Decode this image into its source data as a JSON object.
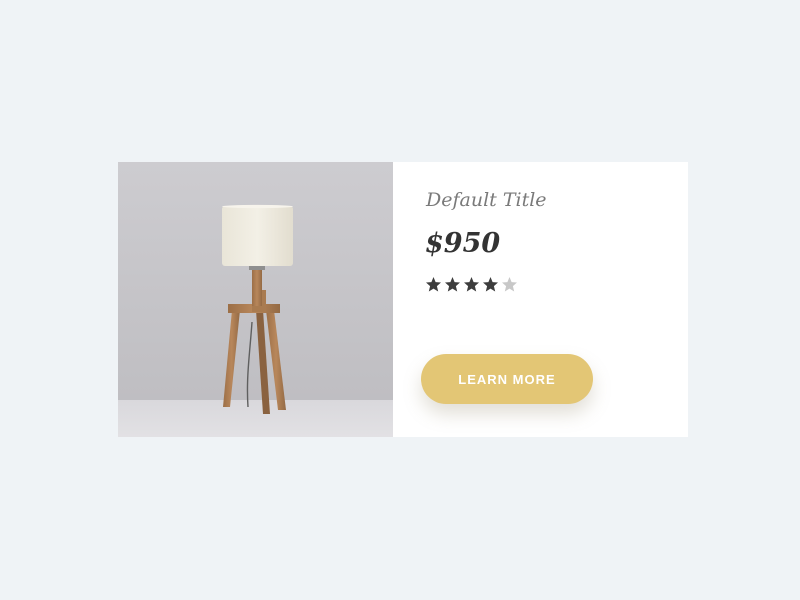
{
  "product": {
    "image_alt": "wooden tripod table lamp with white drum shade",
    "title": "Default Title",
    "price": "$950",
    "rating": {
      "value": 4,
      "max": 5
    },
    "cta_label": "LEARN MORE"
  },
  "colors": {
    "page_background": "#eff3f6",
    "card_background": "#ffffff",
    "accent": "#e3c675",
    "star_filled": "#3d3d3d",
    "star_empty": "#c8c8c8",
    "title_text": "#7a7a7a",
    "price_text": "#333333"
  },
  "icons": {
    "star_filled": "star-filled-icon",
    "star_empty": "star-empty-icon"
  }
}
